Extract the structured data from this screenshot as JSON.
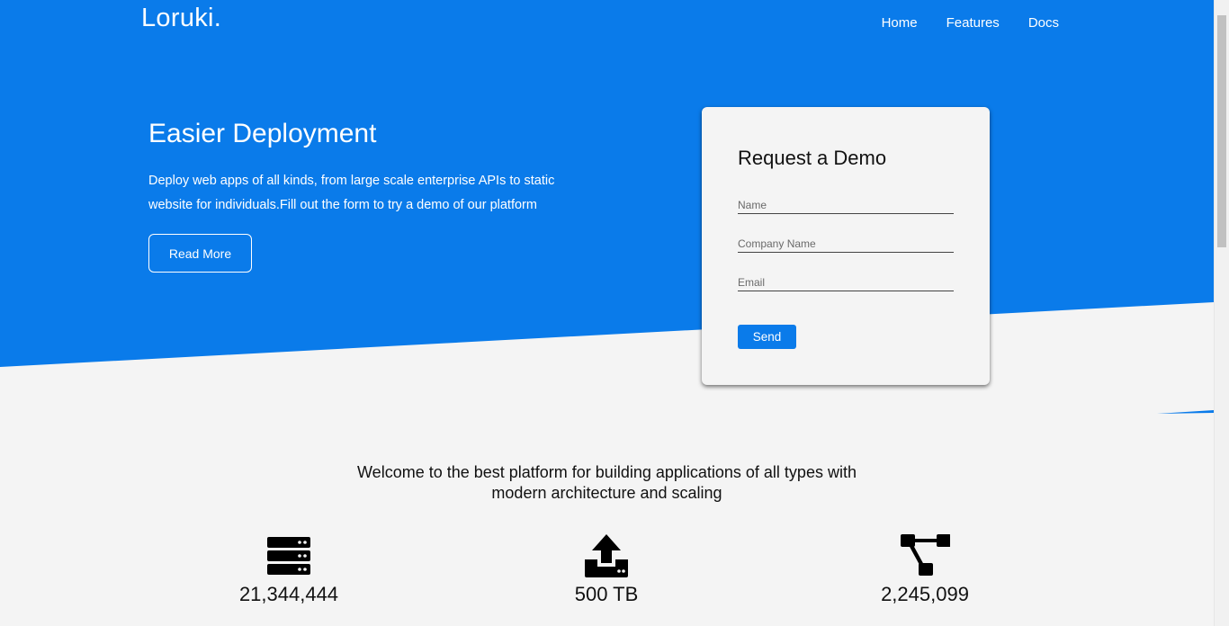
{
  "colors": {
    "primary": "#0a7bea",
    "background": "#f4f4f4",
    "text": "#111111"
  },
  "header": {
    "brand": "Loruki.",
    "nav": [
      {
        "label": "Home"
      },
      {
        "label": "Features"
      },
      {
        "label": "Docs"
      }
    ]
  },
  "hero": {
    "title": "Easier Deployment",
    "text": "Deploy web apps of all kinds, from large scale enterprise APIs to static website for individuals.Fill out the form to try a demo of our platform",
    "button_label": "Read More"
  },
  "demo_form": {
    "title": "Request a Demo",
    "name_placeholder": "Name",
    "company_placeholder": "Company Name",
    "email_placeholder": "Email",
    "send_label": "Send"
  },
  "stats": {
    "intro": "Welcome to the best platform for building applications of all types with modern architecture and scaling",
    "items": [
      {
        "icon": "server-icon",
        "value": "21,344,444"
      },
      {
        "icon": "upload-icon",
        "value": "500 TB"
      },
      {
        "icon": "project-diagram-icon",
        "value": "2,245,099"
      }
    ]
  }
}
